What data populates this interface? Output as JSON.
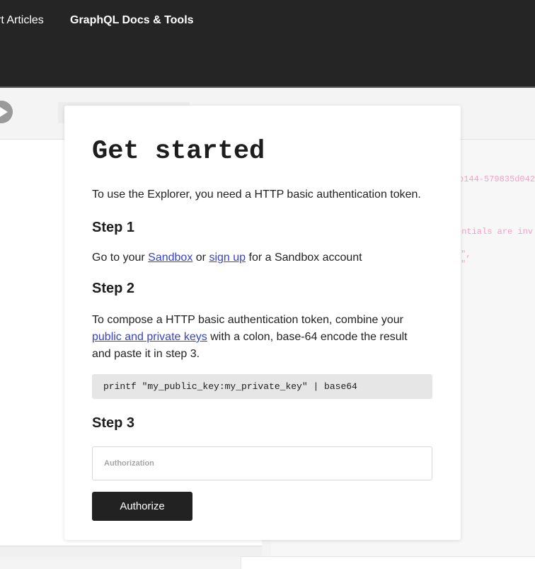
{
  "nav": {
    "articles_label": "rt Articles",
    "docs_label": "GraphQL Docs & Tools"
  },
  "background": {
    "code_fragments": [
      "b144-579835d042",
      "entials are inv",
      "\",",
      "\""
    ]
  },
  "modal": {
    "title": "Get started",
    "intro": "To use the Explorer, you need a HTTP basic authentication token.",
    "step1": {
      "heading": "Step 1",
      "text_before": "Go to your ",
      "sandbox_link": "Sandbox",
      "text_mid": " or ",
      "signup_link": "sign up",
      "text_after": " for a Sandbox account"
    },
    "step2": {
      "heading": "Step 2",
      "text_before": "To compose a HTTP basic authentication token, combine your ",
      "keys_link": "public and private keys",
      "text_after": " with a colon, base-64 encode the result and paste it in step 3.",
      "code": "printf \"my_public_key:my_private_key\" | base64"
    },
    "step3": {
      "heading": "Step 3",
      "input_placeholder": "Authorization",
      "input_value": "",
      "button_label": "Authorize"
    }
  },
  "colors": {
    "nav_bg": "#252525",
    "link": "#3742c7",
    "code_bg": "#e6e6e6",
    "button_bg": "#222222",
    "code_fragment": "#f5a0c8"
  },
  "icons": {
    "run_button": "play-icon"
  }
}
